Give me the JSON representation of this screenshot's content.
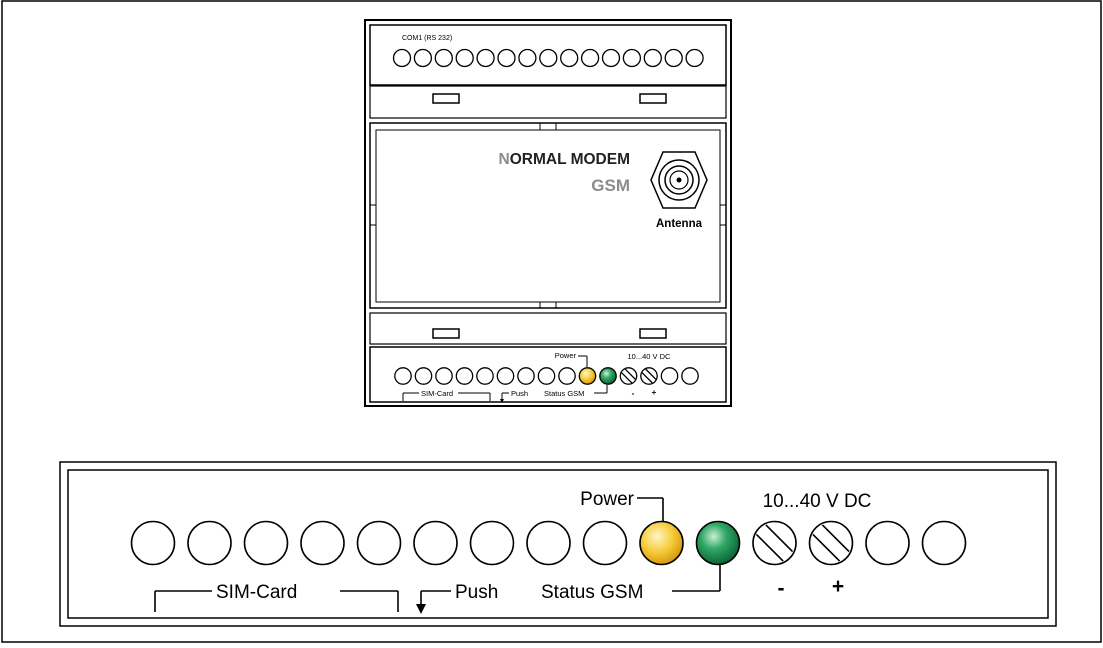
{
  "modem": {
    "com_label": "COM1 (RS 232)",
    "brand_first_letter": "N",
    "brand_rest": "ORMAL MODEM",
    "subtitle": "GSM",
    "antenna_label": "Antenna"
  },
  "terminals_small": {
    "power_label": "Power",
    "voltage_label": "10...40 V DC",
    "sim_label": "SIM-Card",
    "push_label": "Push",
    "status_label": "Status GSM",
    "minus_label": "-",
    "plus_label": "+"
  },
  "terminals_large": {
    "power_label": "Power",
    "voltage_label": "10...40 V DC",
    "sim_label": "SIM-Card",
    "push_label": "Push",
    "status_label": "Status GSM",
    "minus_label": "-",
    "plus_label": "+"
  },
  "colors": {
    "power_led": "#f2c230",
    "status_led": "#138a4a",
    "brand_accent": "#8c8c8c"
  }
}
